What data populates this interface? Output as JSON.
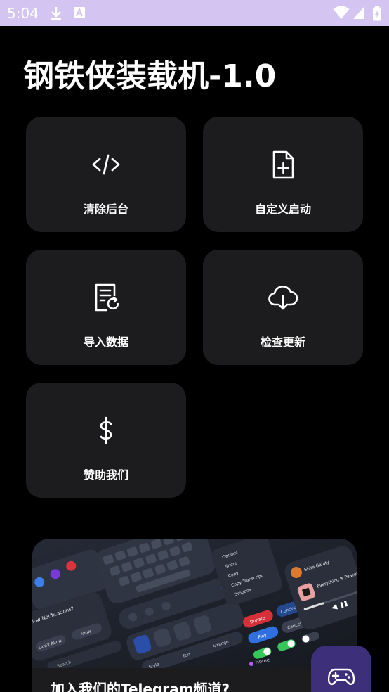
{
  "status_bar": {
    "time": "5:04",
    "background": "#d4c4f2",
    "icons": [
      "download-icon",
      "text-a-icon",
      "wifi-icon",
      "signal-icon",
      "battery-icon"
    ]
  },
  "app": {
    "title": "钢铁侠装载机-1.0"
  },
  "tiles": [
    {
      "label": "清除后台",
      "icon": "code-icon"
    },
    {
      "label": "自定义启动",
      "icon": "file-plus-icon"
    },
    {
      "label": "导入数据",
      "icon": "document-refresh-icon"
    },
    {
      "label": "检查更新",
      "icon": "cloud-download-icon"
    },
    {
      "label": "赞助我们",
      "icon": "dollar-icon"
    }
  ],
  "banner": {
    "caption": "加入我们的Telegram频道?",
    "mockup_texts": {
      "notif_title": "Allow Notifications?",
      "dont_allow": "Don't Allow",
      "allow": "Allow",
      "donate": "Donate",
      "continue": "Continue",
      "play": "Play",
      "cancel": "Cancel",
      "style": "Style",
      "text": "Text",
      "arrange": "Arrange",
      "menu_options": [
        "Options",
        "Share",
        "Copy",
        "Copy Transcript",
        "Dropbox"
      ],
      "now_playing": "Everything Is Peaceful",
      "artist": "Shira Galaty",
      "search": "Search",
      "home": "Home"
    }
  },
  "fab": {
    "icon": "gamepad-icon",
    "color": "#3d2f7a"
  },
  "colors": {
    "background": "#000000",
    "tile": "#1c1c1e",
    "accent": "#3d2f7a"
  }
}
